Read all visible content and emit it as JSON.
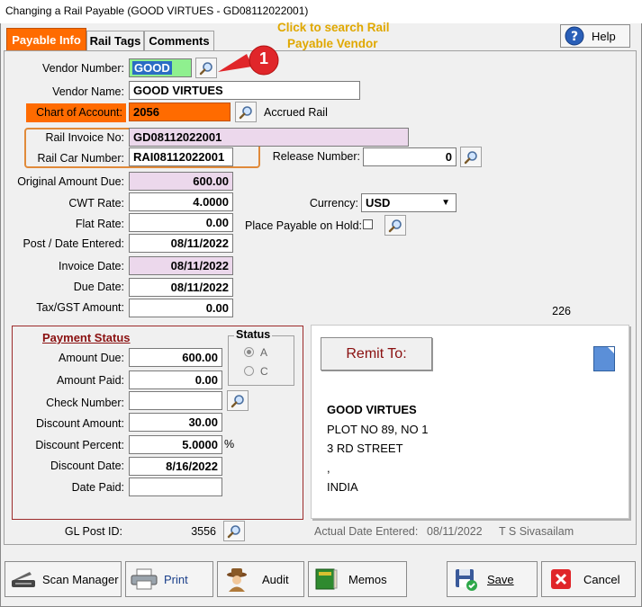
{
  "window": {
    "title": "Changing a Rail Payable  (GOOD VIRTUES - GD08112022001)"
  },
  "tabs": [
    "Payable Info",
    "Rail Tags",
    "Comments"
  ],
  "help_label": "Help",
  "callout": {
    "text_line1": "Click to search Rail",
    "text_line2": "Payable Vendor",
    "number": "1"
  },
  "form": {
    "vendor_number_label": "Vendor Number:",
    "vendor_number": "GOOD",
    "vendor_name_label": "Vendor Name:",
    "vendor_name": "GOOD VIRTUES",
    "chart_label": "Chart of Account:",
    "chart_value": "2056",
    "chart_desc": "Accrued Rail",
    "rail_invoice_label": "Rail Invoice No:",
    "rail_invoice": "GD08112022001",
    "rail_car_label": "Rail Car Number:",
    "rail_car": "RAI08112022001",
    "release_label": "Release Number:",
    "release_value": "0",
    "orig_amount_label": "Original Amount Due:",
    "orig_amount": "600.00",
    "cwt_label": "CWT Rate:",
    "cwt": "4.0000",
    "currency_label": "Currency:",
    "currency": "USD",
    "flat_label": "Flat Rate:",
    "flat": "0.00",
    "hold_label": "Place Payable on Hold:",
    "post_label": "Post / Date Entered:",
    "post_date": "08/11/2022",
    "invoice_date_label": "Invoice Date:",
    "invoice_date": "08/11/2022",
    "due_date_label": "Due Date:",
    "due_date": "08/11/2022",
    "tax_label": "Tax/GST Amount:",
    "tax": "0.00",
    "count_value": "226"
  },
  "payment": {
    "title": "Payment Status",
    "amount_due_label": "Amount Due:",
    "amount_due": "600.00",
    "amount_paid_label": "Amount Paid:",
    "amount_paid": "0.00",
    "check_label": "Check Number:",
    "check": "",
    "discount_amount_label": "Discount Amount:",
    "discount_amount": "30.00",
    "discount_percent_label": "Discount Percent:",
    "discount_percent": "5.0000",
    "percent_sign": "%",
    "discount_date_label": "Discount Date:",
    "discount_date": "8/16/2022",
    "date_paid_label": "Date Paid:",
    "date_paid": "",
    "status_title": "Status",
    "status_a": "A",
    "status_c": "C"
  },
  "remit": {
    "button_label": "Remit To:",
    "lines": [
      "GOOD VIRTUES",
      "PLOT NO 89, NO 1",
      "3 RD STREET",
      ",",
      "INDIA"
    ]
  },
  "footer": {
    "gl_label": "GL Post ID:",
    "gl_value": "3556",
    "actual_label": "Actual Date Entered:",
    "actual_date": "08/11/2022",
    "user": "T S Sivasailam"
  },
  "buttons": {
    "scan": "Scan Manager",
    "print": "Print",
    "audit": "Audit",
    "memos": "Memos",
    "save": "Save",
    "cancel": "Cancel"
  },
  "colors": {
    "accent": "#ff6b00",
    "pink": "#ecd8ec",
    "callout": "#e0262a",
    "hint": "#e0a800",
    "border_box": "#e08a3a"
  }
}
